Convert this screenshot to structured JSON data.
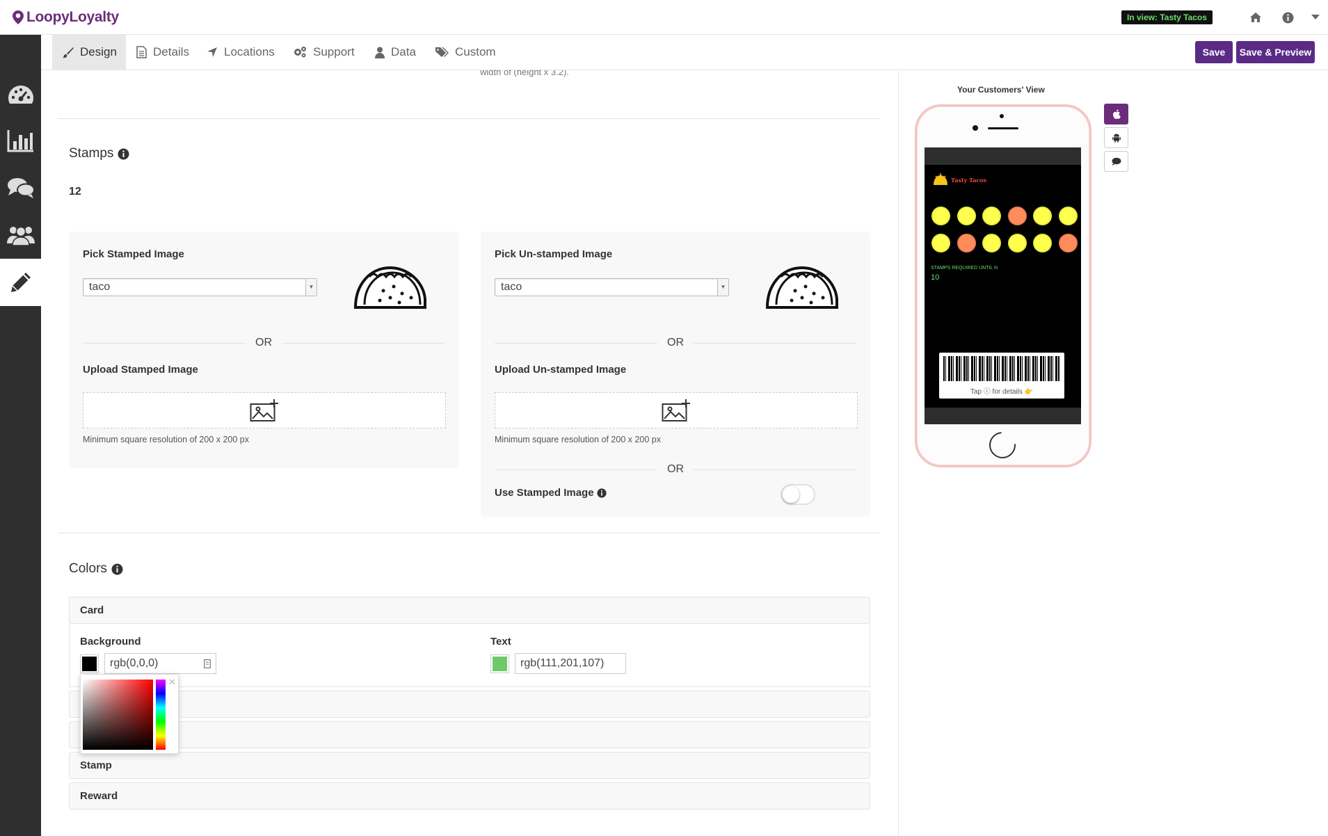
{
  "app": {
    "name": "LoopyLoyalty",
    "in_view": "In view: Tasty Tacos"
  },
  "tabs": [
    {
      "label": "Design"
    },
    {
      "label": "Details"
    },
    {
      "label": "Locations"
    },
    {
      "label": "Support"
    },
    {
      "label": "Data"
    },
    {
      "label": "Custom"
    }
  ],
  "actions": {
    "save": "Save",
    "save_preview": "Save & Preview"
  },
  "main": {
    "cut_text": "width of (height x 3.2).",
    "stamps": {
      "title": "Stamps",
      "count": "12",
      "stamped": {
        "pick_label": "Pick Stamped Image",
        "select_value": "taco",
        "or": "OR",
        "upload_label": "Upload Stamped Image",
        "hint": "Minimum square resolution of 200 x 200 px"
      },
      "unstamped": {
        "pick_label": "Pick Un-stamped Image",
        "select_value": "taco",
        "or": "OR",
        "upload_label": "Upload Un-stamped Image",
        "hint": "Minimum square resolution of 200 x 200 px",
        "or2": "OR",
        "use_stamped_label": "Use Stamped Image"
      }
    },
    "colors": {
      "title": "Colors",
      "card": {
        "title": "Card",
        "background_label": "Background",
        "background_value": "rgb(0,0,0)",
        "text_label": "Text",
        "text_value": "rgb(111,201,107)"
      },
      "stamp_title": "Stamp",
      "reward_title": "Reward",
      "swatches": {
        "background": "#000000",
        "text": "#6fc96b"
      }
    }
  },
  "preview": {
    "title": "Your Customers' View",
    "card_name": "Tasty Tacos",
    "stamps_label": "STAMPS REQUIRED UNTIL N",
    "stamps_value": "10",
    "tap_details": "Tap ⓘ for details 👉"
  },
  "colors": {
    "brand": "#5b2a86",
    "sidebar": "#2f2f2f",
    "stamped": "#ffff4d",
    "unstamped": "#ff8c5a"
  }
}
